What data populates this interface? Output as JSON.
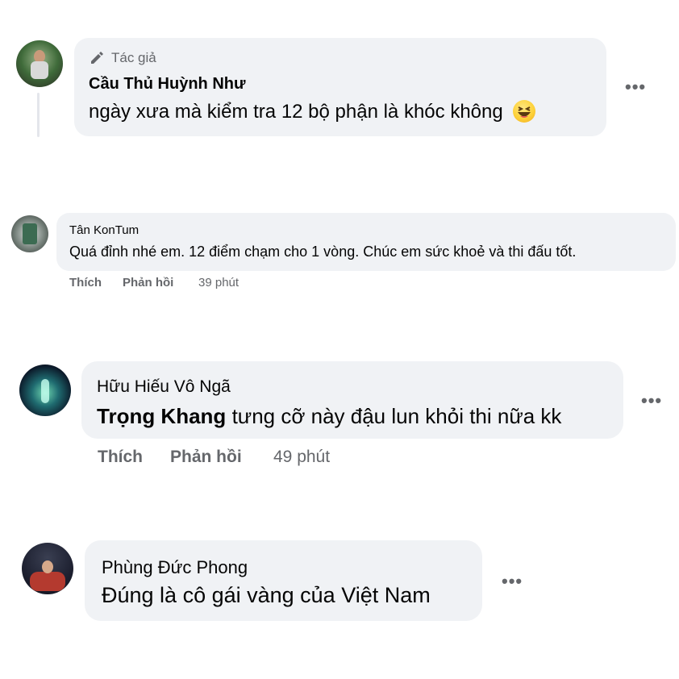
{
  "comments": [
    {
      "badge_icon": "pencil-icon",
      "badge": "Tác giả",
      "author": "Cầu Thủ Huỳnh Như",
      "text": "ngày xưa mà kiểm tra 12 bộ phận là khóc không",
      "emoji": "laughing-emoji"
    },
    {
      "author": "Tân KonTum",
      "text": "Quá đỉnh nhé em. 12 điểm chạm cho 1 vòng. Chúc em sức khoẻ và thi đấu tốt.",
      "like_label": "Thích",
      "reply_label": "Phản hồi",
      "time": "39 phút"
    },
    {
      "author": "Hữu Hiếu Vô Ngã",
      "mention": "Trọng Khang",
      "text": "tưng cỡ này đậu lun khỏi thi nữa kk",
      "like_label": "Thích",
      "reply_label": "Phản hồi",
      "time": "49 phút"
    },
    {
      "author": "Phùng Đức Phong",
      "text": "Đúng là cô gái vàng của Việt Nam"
    }
  ],
  "more_icon": "•••"
}
